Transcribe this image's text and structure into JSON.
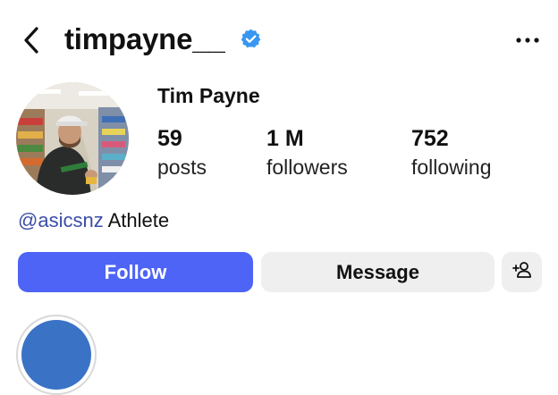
{
  "header": {
    "username": "timpayne__",
    "back_icon": "chevron-left-icon",
    "verified_icon": "verified-badge-icon",
    "more_icon": "more-horizontal-icon"
  },
  "profile": {
    "display_name": "Tim Payne",
    "avatar": "profile-photo",
    "stats": {
      "posts": {
        "value": "59",
        "label": "posts"
      },
      "followers": {
        "value": "1 M",
        "label": "followers"
      },
      "following": {
        "value": "752",
        "label": "following"
      }
    },
    "bio": {
      "mention": "@asicsnz",
      "text": " Athlete"
    }
  },
  "actions": {
    "follow_label": "Follow",
    "message_label": "Message",
    "add_user_icon": "add-person-icon"
  },
  "colors": {
    "accent": "#4d64f6",
    "mention": "#3b4ea8",
    "verified": "#3897f0",
    "secondary_button": "#efefef"
  }
}
